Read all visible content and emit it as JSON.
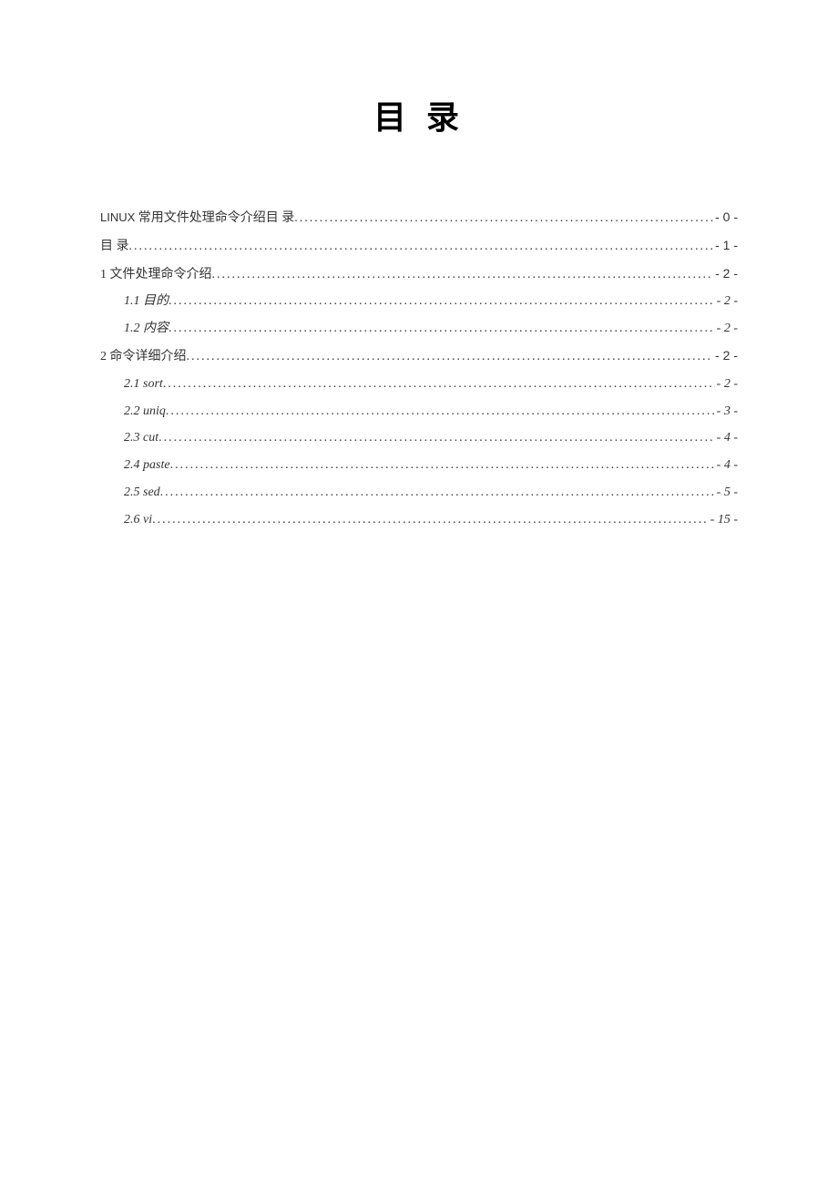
{
  "title": "目 录",
  "toc": {
    "entries": [
      {
        "label_prefix": "LINUX",
        "label": " 常用文件处理命令介绍目 录",
        "page": "- 0 -",
        "indent": 0,
        "italic": false,
        "smallcaps": true
      },
      {
        "label_prefix": "",
        "label": "目 录",
        "page": "- 1 -",
        "indent": 0,
        "italic": false,
        "smallcaps": false
      },
      {
        "label_prefix": "",
        "label": "1 文件处理命令介绍",
        "page": "- 2 -",
        "indent": 0,
        "italic": false,
        "smallcaps": false
      },
      {
        "label_prefix": "1.1 ",
        "label": "目的",
        "page": "- 2 -",
        "indent": 1,
        "italic": true,
        "smallcaps": false
      },
      {
        "label_prefix": "1.2 ",
        "label": "内容",
        "page": "- 2 -",
        "indent": 1,
        "italic": true,
        "smallcaps": false
      },
      {
        "label_prefix": "",
        "label": "2 命令详细介绍",
        "page": "- 2 -",
        "indent": 0,
        "italic": false,
        "smallcaps": false
      },
      {
        "label_prefix": "2.1 sort",
        "label": "",
        "page": "- 2 -",
        "indent": 1,
        "italic": true,
        "smallcaps": false
      },
      {
        "label_prefix": "2.2 uniq",
        "label": "",
        "page": "- 3 -",
        "indent": 1,
        "italic": true,
        "smallcaps": false
      },
      {
        "label_prefix": "2.3 cut",
        "label": "",
        "page": "- 4 -",
        "indent": 1,
        "italic": true,
        "smallcaps": false
      },
      {
        "label_prefix": "2.4 paste",
        "label": "",
        "page": "- 4 -",
        "indent": 1,
        "italic": true,
        "smallcaps": false
      },
      {
        "label_prefix": "2.5 sed",
        "label": "",
        "page": "- 5 -",
        "indent": 1,
        "italic": true,
        "smallcaps": false
      },
      {
        "label_prefix": "2.6 vi",
        "label": "",
        "page": "- 15 -",
        "indent": 1,
        "italic": true,
        "smallcaps": false
      }
    ]
  }
}
